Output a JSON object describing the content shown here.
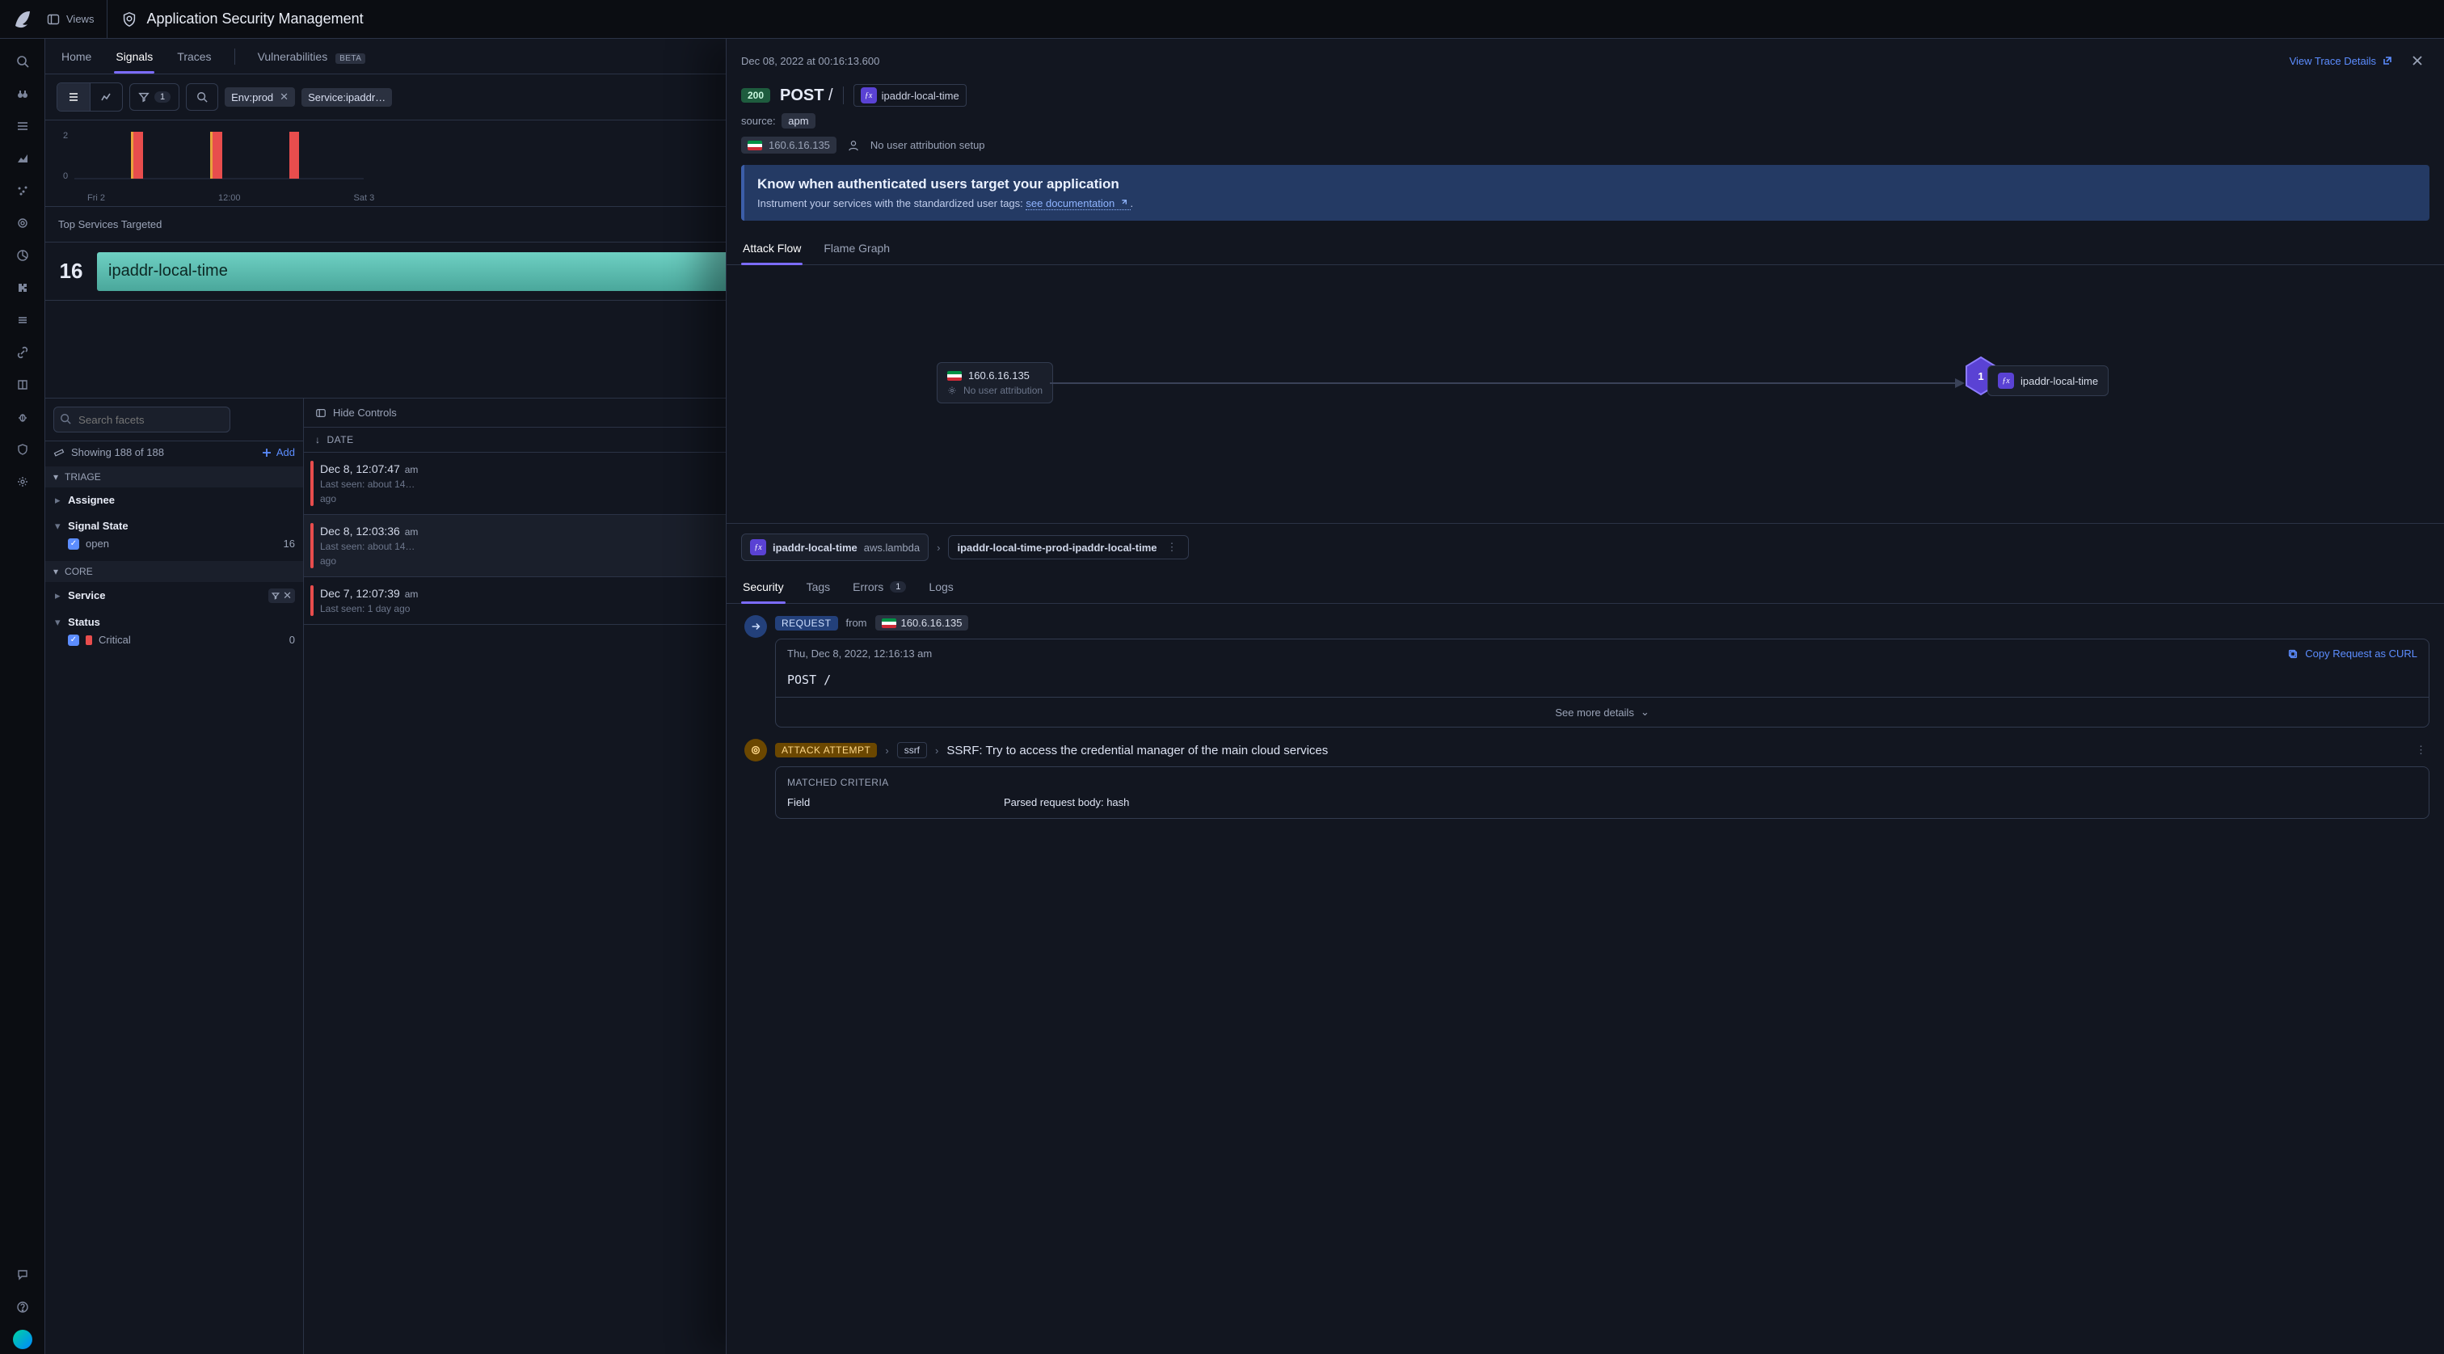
{
  "topbar": {
    "views": "Views",
    "title": "Application Security Management"
  },
  "subtabs": {
    "home": "Home",
    "signals": "Signals",
    "traces": "Traces",
    "vulnerabilities": "Vulnerabilities",
    "beta": "BETA"
  },
  "toolbar": {
    "filter_count": "1",
    "chip_env": "Env:prod",
    "chip_svc": "Service:ipaddr…"
  },
  "chart_data": {
    "type": "bar",
    "y_ticks": [
      0,
      2
    ],
    "x_ticks": [
      "Fri 2",
      "12:00",
      "Sat 3"
    ],
    "bars": [
      {
        "x": 70,
        "h": 58,
        "sev": "#e8a23c"
      },
      {
        "x": 73,
        "h": 58,
        "sev": "#e84d4d"
      },
      {
        "x": 168,
        "h": 58,
        "sev": "#e8a23c"
      },
      {
        "x": 171,
        "h": 58,
        "sev": "#e84d4d"
      },
      {
        "x": 266,
        "h": 58,
        "sev": "#e84d4d"
      }
    ],
    "height": 66
  },
  "top_services": {
    "hdr": "Top Services Targeted",
    "count": "16",
    "name": "ipaddr-local-time"
  },
  "facets": {
    "search_placeholder": "Search facets",
    "showing": "Showing 188 of 188",
    "add": "Add",
    "triage": "TRIAGE",
    "assignee": "Assignee",
    "signal_state": "Signal State",
    "open_label": "open",
    "open_count": "16",
    "core": "CORE",
    "service": "Service",
    "status": "Status",
    "critical_label": "Critical",
    "critical_count": "0"
  },
  "events": {
    "hide_controls": "Hide Controls",
    "date_col": "DATE",
    "items": [
      {
        "time": "Dec 8, 12:07:47",
        "ampm": "am",
        "sub": "Last seen: about 14…",
        "sub2": "ago"
      },
      {
        "time": "Dec 8, 12:03:36",
        "ampm": "am",
        "sub": "Last seen: about 14…",
        "sub2": "ago"
      },
      {
        "time": "Dec 7, 12:07:39",
        "ampm": "am",
        "sub": "Last seen: 1 day ago",
        "sub2": ""
      }
    ]
  },
  "panel": {
    "attime": "Dec 08, 2022 at 00:16:13.600",
    "view_trace": "View Trace Details",
    "status": "200",
    "method": "POST",
    "path": "/",
    "service": "ipaddr-local-time",
    "source_k": "source:",
    "source_v": "apm",
    "ip": "160.6.16.135",
    "nouser": "No user attribution setup",
    "info_h": "Know when authenticated users target your application",
    "info_b1": "Instrument your services with the standardized user tags: ",
    "info_link": "see documentation",
    "tabs": {
      "flow": "Attack Flow",
      "flame": "Flame Graph"
    },
    "flow": {
      "src_ip": "160.6.16.135",
      "src_sub": "No user attribution",
      "hex": "1",
      "dst": "ipaddr-local-time"
    },
    "crumbs": {
      "svc": "ipaddr-local-time",
      "meta": "aws.lambda",
      "dst": "ipaddr-local-time-prod-ipaddr-local-time"
    },
    "tabs2": {
      "security": "Security",
      "tags": "Tags",
      "errors": "Errors",
      "errors_n": "1",
      "logs": "Logs"
    },
    "sec": {
      "request_pill": "REQUEST",
      "from": "from",
      "ip": "160.6.16.135",
      "time": "Thu, Dec 8, 2022, 12:16:13 am",
      "copy": "Copy Request as CURL",
      "method_path": "POST  /",
      "see_more": "See more details",
      "attack_pill": "ATTACK ATTEMPT",
      "ssrf": "ssrf",
      "ssrf_desc": "SSRF: Try to access the credential manager of the main cloud services",
      "mc_h": "MATCHED CRITERIA",
      "mc_field": "Field",
      "mc_val": "Parsed request body: hash"
    }
  }
}
